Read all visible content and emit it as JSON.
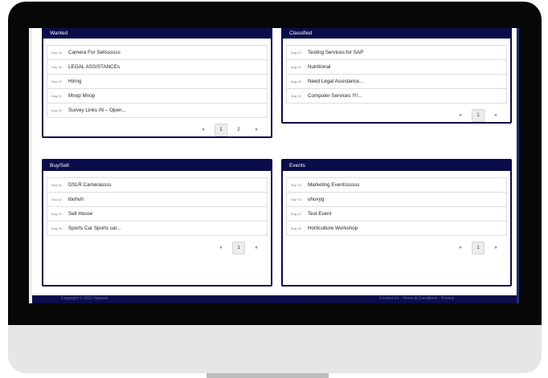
{
  "panels": {
    "wanted": {
      "title": "Wanted",
      "items": [
        {
          "date": "Sep 18",
          "title": "Camera For Sellssssss"
        },
        {
          "date": "Sep 18",
          "title": "LEGAL ASSISTANCEs"
        },
        {
          "date": "Sep 13",
          "title": "Hiring"
        },
        {
          "date": "Aug 24",
          "title": "Mnop Mnop"
        },
        {
          "date": "Aug 18",
          "title": "Survey Links IN – Open..."
        }
      ],
      "pagination": {
        "prev": "«",
        "pages": [
          "1",
          "2"
        ],
        "next": "»"
      }
    },
    "classified": {
      "title": "Classified",
      "items": [
        {
          "date": "Aug 22",
          "title": "Testing Services for SAP"
        },
        {
          "date": "Aug 21",
          "title": "Nutritional"
        },
        {
          "date": "Aug 16",
          "title": "Need Legal Assistance..."
        },
        {
          "date": "Aug 16",
          "title": "Computer Services !!!!..."
        }
      ],
      "pagination": {
        "prev": "«",
        "pages": [
          "1"
        ],
        "next": "»"
      }
    },
    "buysell": {
      "title": "Buy/Sell",
      "items": [
        {
          "date": "Sep 18",
          "title": "DSLR Camerassss"
        },
        {
          "date": "Sep 12",
          "title": "ibuhuh"
        },
        {
          "date": "Aug 23",
          "title": "Sell House"
        },
        {
          "date": "Aug 16",
          "title": "Sports Car Sports car..."
        }
      ],
      "pagination": {
        "prev": "«",
        "pages": [
          "1"
        ],
        "next": "»"
      }
    },
    "events": {
      "title": "Events",
      "items": [
        {
          "date": "Sep 18",
          "title": "Marketing Eventssssss"
        },
        {
          "date": "Sep 13",
          "title": "uhuvyg"
        },
        {
          "date": "Aug 22",
          "title": "Test Event"
        },
        {
          "date": "Aug 16",
          "title": "Horticulture Workshop"
        }
      ],
      "pagination": {
        "prev": "«",
        "pages": [
          "1"
        ],
        "next": "»"
      }
    }
  },
  "footer": {
    "copyright": "Copyright © 2022 Haaasis",
    "links": "Contact Us · Terms & Conditions · Privacy"
  },
  "colors": {
    "header": "#0b0d4b",
    "bezel": "#070707",
    "monitor_body": "#e6e6e6"
  }
}
